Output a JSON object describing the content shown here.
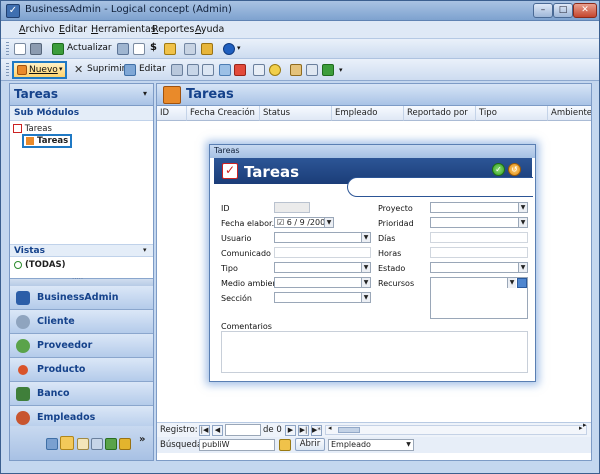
{
  "window": {
    "title": "BusinessAdmin - Logical concept (Admin)",
    "controls": {
      "min": "–",
      "max": "□",
      "close": "✕"
    }
  },
  "menubar": [
    "Archivo",
    "Editar",
    "Herramientas",
    "Reportes",
    "Ayuda"
  ],
  "toolbar1": {
    "actualizar": "Actualizar",
    "dollar": "$"
  },
  "toolbar2": {
    "nuevo": "Nuevo",
    "suprimir": "Suprimir",
    "editar": "Editar"
  },
  "left": {
    "title": "Tareas",
    "sub_modules_label": "Sub Módulos",
    "tree_root": "Tareas",
    "tree_child": "Tareas",
    "vistas_label": "Vistas",
    "todas": "(TODAS)",
    "splitter_dots": ".....",
    "nav": [
      "BusinessAdmin",
      "Cliente",
      "Proveedor",
      "Producto",
      "Banco",
      "Empleados"
    ],
    "more": "»"
  },
  "main": {
    "title": "Tareas",
    "columns": [
      "ID",
      "Fecha Creación",
      "Status",
      "Empleado",
      "Reportado por",
      "Tipo",
      "Ambiente"
    ],
    "registro_label": "Registro:",
    "registro_of": "de 0",
    "busqueda_label": "Búsqueda",
    "busqueda_value": "publiW",
    "abrir": "Abrir",
    "filter_field": "Empleado"
  },
  "dialog": {
    "caption": "Tareas",
    "title": "Tareas",
    "left_labels": [
      "ID",
      "Fecha elabor.",
      "Usuario",
      "Comunicado por",
      "Tipo",
      "Medio ambiente",
      "Sección"
    ],
    "fecha_value": "6 / 9 /2008",
    "right_labels": [
      "Proyecto",
      "Prioridad",
      "Días",
      "Horas",
      "Estado",
      "Recursos"
    ],
    "comentarios_label": "Comentarios"
  },
  "colors": {
    "accent": "#15428b",
    "highlight_border": "#1f79c4",
    "dialog_header": "#1b3d78"
  }
}
